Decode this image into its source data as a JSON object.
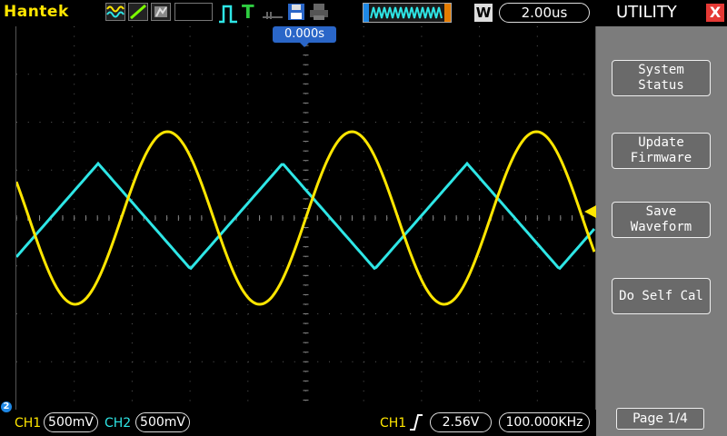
{
  "brand": "Hantek",
  "top_icons": [
    "waveform-mode-icon",
    "ramp-display-icon",
    "persist-icon",
    "trigger-edge-icon",
    "trigger-t-icon",
    "trigger-marker-icon",
    "save-disk-icon",
    "print-icon"
  ],
  "run_status": "waveform-run-indicator",
  "wave_button": "W",
  "timebase": "2.00us",
  "trigger_position": "0.000s",
  "menu": {
    "title": "UTILITY",
    "close": "X",
    "buttons": [
      {
        "line1": "System",
        "line2": "Status"
      },
      {
        "line1": "Update",
        "line2": "Firmware"
      },
      {
        "line1": "Save",
        "line2": "Waveform"
      },
      {
        "line1": "Do Self Cal",
        "line2": ""
      }
    ],
    "page": "Page 1/4"
  },
  "status": {
    "channel_marker": "2",
    "ch1_label": "CH1",
    "ch1_scale": "500mV",
    "ch2_label": "CH2",
    "ch2_scale": "500mV",
    "trig_source": "CH1",
    "trig_level": "2.56V",
    "frequency": "100.000KHz"
  },
  "colors": {
    "ch1": "#ffe600",
    "ch2": "#2ee6e6",
    "accent": "#2a66c8",
    "grid": "#5a5a5a"
  }
}
